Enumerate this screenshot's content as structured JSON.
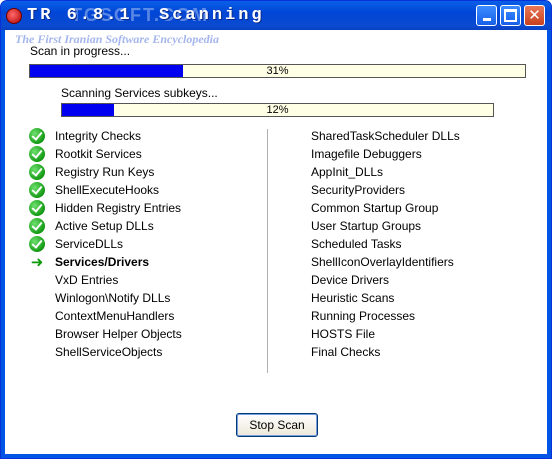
{
  "window": {
    "title": "TR 6.8.1  Scanning",
    "watermark": "TGSOFT.COM",
    "sub_watermark": "The First Iranian Software Encyclopedia"
  },
  "scan": {
    "status_label": "Scan in progress...",
    "progress_text": "31%",
    "progress_value": 0.31
  },
  "subscan": {
    "status_label": "Scanning Services subkeys...",
    "progress_text": "12%",
    "progress_value": 0.12
  },
  "checklist": {
    "left": [
      {
        "label": "Integrity Checks",
        "status": "done"
      },
      {
        "label": "Rootkit Services",
        "status": "done"
      },
      {
        "label": "Registry Run Keys",
        "status": "done"
      },
      {
        "label": "ShellExecuteHooks",
        "status": "done"
      },
      {
        "label": "Hidden Registry Entries",
        "status": "done"
      },
      {
        "label": "Active Setup DLLs",
        "status": "done"
      },
      {
        "label": "ServiceDLLs",
        "status": "done"
      },
      {
        "label": "Services/Drivers",
        "status": "current"
      },
      {
        "label": "VxD Entries",
        "status": "pending"
      },
      {
        "label": "Winlogon\\Notify DLLs",
        "status": "pending"
      },
      {
        "label": "ContextMenuHandlers",
        "status": "pending"
      },
      {
        "label": "Browser Helper Objects",
        "status": "pending"
      },
      {
        "label": "ShellServiceObjects",
        "status": "pending"
      }
    ],
    "right": [
      {
        "label": "SharedTaskScheduler DLLs",
        "status": "pending"
      },
      {
        "label": "Imagefile Debuggers",
        "status": "pending"
      },
      {
        "label": "AppInit_DLLs",
        "status": "pending"
      },
      {
        "label": "SecurityProviders",
        "status": "pending"
      },
      {
        "label": "Common Startup Group",
        "status": "pending"
      },
      {
        "label": "User Startup Groups",
        "status": "pending"
      },
      {
        "label": "Scheduled Tasks",
        "status": "pending"
      },
      {
        "label": "ShellIconOverlayIdentifiers",
        "status": "pending"
      },
      {
        "label": "Device Drivers",
        "status": "pending"
      },
      {
        "label": "Heuristic Scans",
        "status": "pending"
      },
      {
        "label": "Running Processes",
        "status": "pending"
      },
      {
        "label": "HOSTS File",
        "status": "pending"
      },
      {
        "label": "Final Checks",
        "status": "pending"
      }
    ]
  },
  "actions": {
    "stop_label": "Stop Scan"
  },
  "colors": {
    "progress_fill": "#0000f0",
    "progress_bg": "#ffffe6",
    "check": "#139a13",
    "titlebar": "#0046d6"
  }
}
